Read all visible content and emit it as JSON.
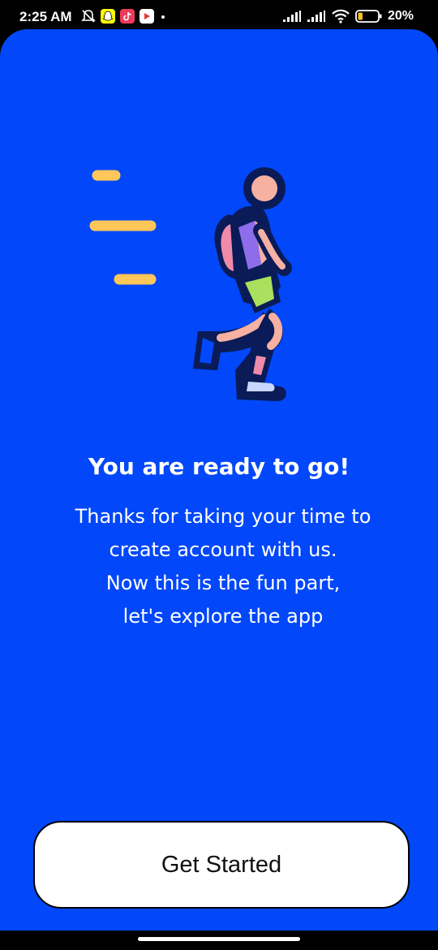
{
  "status_bar": {
    "time": "2:25 AM",
    "battery": "20%",
    "icons": [
      "mute-bell-icon",
      "snapchat-icon",
      "tiktok-icon",
      "youtube-icon",
      "dot-icon",
      "signal-icon",
      "signal-icon",
      "wifi-icon",
      "battery-icon"
    ]
  },
  "onboarding": {
    "title": "You are ready to go!",
    "lines": [
      "Thanks for taking your time to",
      "create account with us.",
      "Now this is the fun part,",
      "let's explore the app"
    ],
    "cta_label": "Get Started"
  },
  "colors": {
    "background": "#0247F9",
    "accent_lines": "#FFC65A",
    "button_bg": "#FFFFFF"
  }
}
